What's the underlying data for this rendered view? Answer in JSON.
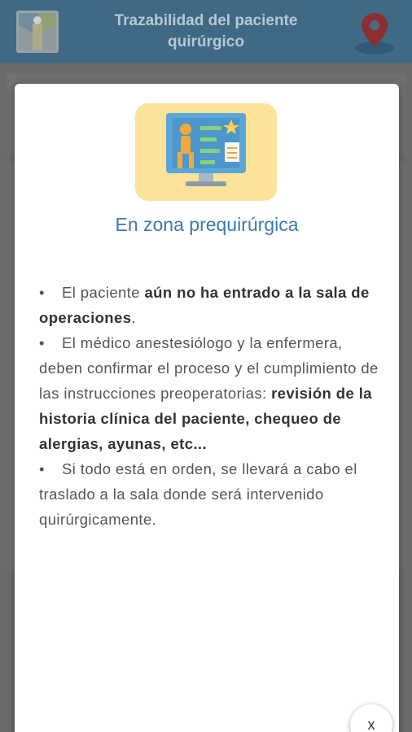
{
  "header": {
    "title": "Trazabilidad del paciente quirúrgico",
    "logo_icon": "hospital-logo-icon",
    "location_icon": "location-pin-icon"
  },
  "modal": {
    "illustration_icon": "monitor-patient-illustration-icon",
    "title": "En zona prequirúrgica",
    "bullets": [
      {
        "parts": [
          {
            "text": "El paciente ",
            "bold": false
          },
          {
            "text": "aún no ha entrado a la sala de operaciones",
            "bold": true
          },
          {
            "text": ".",
            "bold": false
          }
        ]
      },
      {
        "parts": [
          {
            "text": "El médico anestesiólogo y la enfermera, deben confirmar el proceso y el cumplimiento de las instrucciones preoperatorias: ",
            "bold": false
          },
          {
            "text": "revisión de la historia clínica del paciente, chequeo de alergias, ayunas, etc...",
            "bold": true
          }
        ]
      },
      {
        "parts": [
          {
            "text": "Si todo está en orden, se llevará a cabo el traslado a la sala donde será intervenido quirúrgicamente.",
            "bold": false
          }
        ]
      }
    ],
    "close_label": "x"
  },
  "colors": {
    "header_bg": "#3f6985",
    "title_blue": "#3d7ab0",
    "illustration_bg": "#fde29a"
  }
}
